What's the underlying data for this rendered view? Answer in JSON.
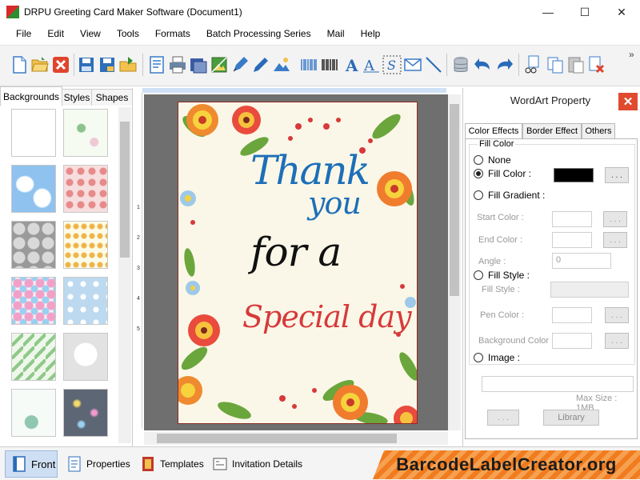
{
  "window": {
    "title": "DRPU Greeting Card Maker Software (Document1)",
    "controls": {
      "minimize": "—",
      "maximize": "☐",
      "close": "✕"
    }
  },
  "menu": [
    "File",
    "Edit",
    "View",
    "Tools",
    "Formats",
    "Batch Processing Series",
    "Mail",
    "Help"
  ],
  "toolbar": {
    "icons": [
      "new-icon",
      "open-icon",
      "close-doc-icon",
      "save-icon",
      "save-as-icon",
      "export-icon",
      "properties-icon",
      "print-icon",
      "print-preview-icon",
      "image-icon",
      "pen-icon",
      "shape-tool-icon",
      "linear-barcode-icon",
      "barcode-icon",
      "text-icon",
      "wordart-icon",
      "signature-icon",
      "envelope-icon",
      "line-icon",
      "database-icon",
      "undo-icon",
      "redo-icon",
      "cut-icon",
      "copy-icon",
      "paste-icon",
      "delete-icon"
    ],
    "more": "»"
  },
  "left_panel": {
    "tabs": [
      "Backgrounds",
      "Styles",
      "Shapes"
    ],
    "active_tab": "Backgrounds",
    "thumbnails": [
      "bg-doodle",
      "bg-kids-pattern",
      "bg-sky-clouds",
      "bg-strawberries",
      "bg-grey-hearts",
      "bg-flower-border",
      "bg-pink-floral",
      "bg-blue-snowflakes",
      "bg-green-trees",
      "bg-white-heart",
      "bg-hearts-ornament",
      "bg-sparkles"
    ]
  },
  "ruler": {
    "labels": [
      "1",
      "2",
      "3",
      "4",
      "5"
    ]
  },
  "card": {
    "line1": "Thank",
    "line2": "you",
    "line3": "for a",
    "line4": "Special day",
    "colors": {
      "thank": "#1d6fb8",
      "for_a": "#111111",
      "special": "#d63a3a",
      "background": "#fbf7e8",
      "border": "#8b2b24"
    }
  },
  "wordart": {
    "title": "WordArt Property",
    "close": "✕",
    "tabs": [
      "Color Effects",
      "Border Effect",
      "Others"
    ],
    "active_tab": "Color Effects",
    "fill_group": "Fill Color",
    "options": {
      "none": "None",
      "fill_color": "Fill Color :",
      "fill_gradient": "Fill Gradient :",
      "fill_style": "Fill Style :",
      "image": "Image :"
    },
    "selected": "fill_color",
    "fill_color_value": "#000000",
    "dots": ". . .",
    "start_color": "Start Color :",
    "end_color": "End Color :",
    "angle": "Angle :",
    "angle_value": "0",
    "fill_style_label": "Fill Style :",
    "pen_color": "Pen Color :",
    "background_color": "Background Color :",
    "max_size": "Max Size : 1MB",
    "library": "Library"
  },
  "bottom": {
    "front": "Front",
    "properties": "Properties",
    "templates": "Templates",
    "invitation": "Invitation Details",
    "brand": "BarcodeLabelCreator.org"
  }
}
